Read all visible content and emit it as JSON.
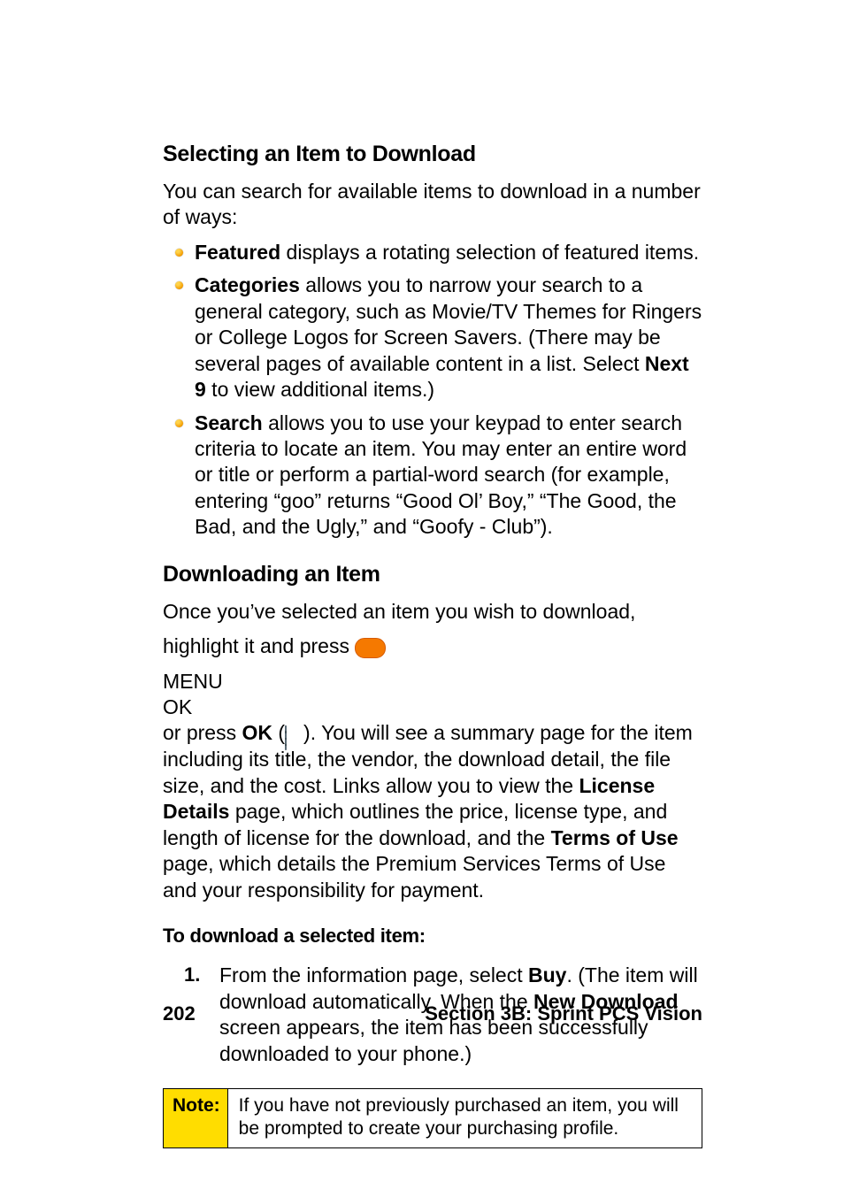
{
  "headings": {
    "selecting": "Selecting an Item to Download",
    "downloading": "Downloading an Item",
    "to_download": "To download a selected item:"
  },
  "intro": "You can search for available items to download in a number of ways:",
  "bullets": {
    "featured": {
      "label": "Featured",
      "rest": " displays a rotating selection of featured items."
    },
    "categories": {
      "label": "Categories",
      "rest_a": " allows you to narrow your search to a general category, such as Movie/TV Themes for Ringers or College Logos for Screen Savers. (There may be several pages of available content in a list. Select ",
      "next9": "Next 9",
      "rest_b": " to view additional items.)"
    },
    "search": {
      "label": "Search",
      "rest": " allows you to use your keypad to enter search criteria to locate an item. You may enter an entire word or title or perform a partial-word search (for example, entering “goo” returns “Good Ol’ Boy,” “The Good, the Bad, and the Ugly,” and “Goofy - Club”)."
    }
  },
  "downloading_intro": "Once you’ve selected an item you wish to download,",
  "downloading_para": {
    "a": "highlight it and press ",
    "b": " or press ",
    "ok": "OK",
    "c": " (",
    "d": "). You will see a summary page for the item including its title, the vendor, the download detail, the file size, and the cost. Links allow you to view the ",
    "license_details": "License Details",
    "e": " page, which outlines the price, license type, and length of license for the download, and the ",
    "terms_of_use": "Terms of Use",
    "f": " page, which details the Premium Services Terms of Use and your responsibility for payment."
  },
  "icons": {
    "menu_top": "MENU",
    "menu_bottom": "OK"
  },
  "steps": {
    "s1_a": "From the information page, select ",
    "buy": "Buy",
    "s1_b": ". (The item will download automatically. When the ",
    "new_download": "New Download",
    "s1_c": " screen appears, the item has been successfully downloaded to your phone.)"
  },
  "note": {
    "label": "Note:",
    "body": "If you have not previously purchased an item, you will be prompted to create your purchasing profile."
  },
  "footer": {
    "page": "202",
    "section": "Section 3B: Sprint PCS Vision"
  }
}
